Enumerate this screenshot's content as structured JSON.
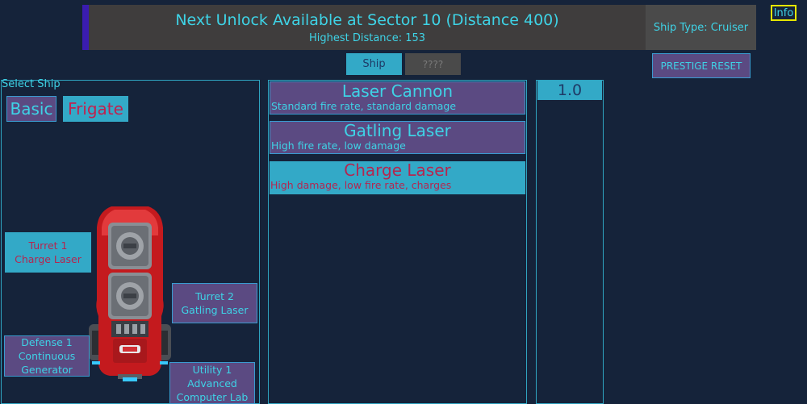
{
  "banner": {
    "next_unlock": "Next Unlock Available at Sector 10 (Distance 400)",
    "highest_distance": "Highest Distance: 153"
  },
  "ship_type": "Ship Type: Cruiser",
  "info_label": "Info",
  "tabs": [
    {
      "label": "Ship",
      "active": true
    },
    {
      "label": "????",
      "active": false
    }
  ],
  "prestige_label": "PRESTIGE RESET",
  "select_ship": {
    "label": "Select Ship",
    "ships": [
      {
        "label": "Basic",
        "selected": false
      },
      {
        "label": "Frigate",
        "selected": true
      }
    ]
  },
  "slots": {
    "turret1": {
      "line1": "Turret 1",
      "line2": "Charge Laser",
      "line3": "",
      "active": true
    },
    "turret2": {
      "line1": "Turret 2",
      "line2": "Gatling Laser",
      "line3": "",
      "active": false
    },
    "defense1": {
      "line1": "Defense 1",
      "line2": "Continuous",
      "line3": "Generator",
      "active": false
    },
    "utility1": {
      "line1": "Utility 1",
      "line2": "Advanced",
      "line3": "Computer Lab",
      "active": false
    }
  },
  "weapons": [
    {
      "name": "Laser Cannon",
      "desc": "Standard fire rate, standard damage",
      "selected": false
    },
    {
      "name": "Gatling Laser",
      "desc": "High fire rate, low damage",
      "selected": false
    },
    {
      "name": "Charge Laser",
      "desc": "High damage, low fire rate, charges",
      "selected": true
    }
  ],
  "level_value": "1.0",
  "colors": {
    "background": "#15233a",
    "accent_cyan": "#33a9c7",
    "button_purple": "#5b4a82",
    "text_cyan": "#3ed3e6",
    "text_red": "#b42650",
    "hull_red": "#c41a1e"
  },
  "icons": {
    "ship": "frigate-ship-sprite"
  }
}
